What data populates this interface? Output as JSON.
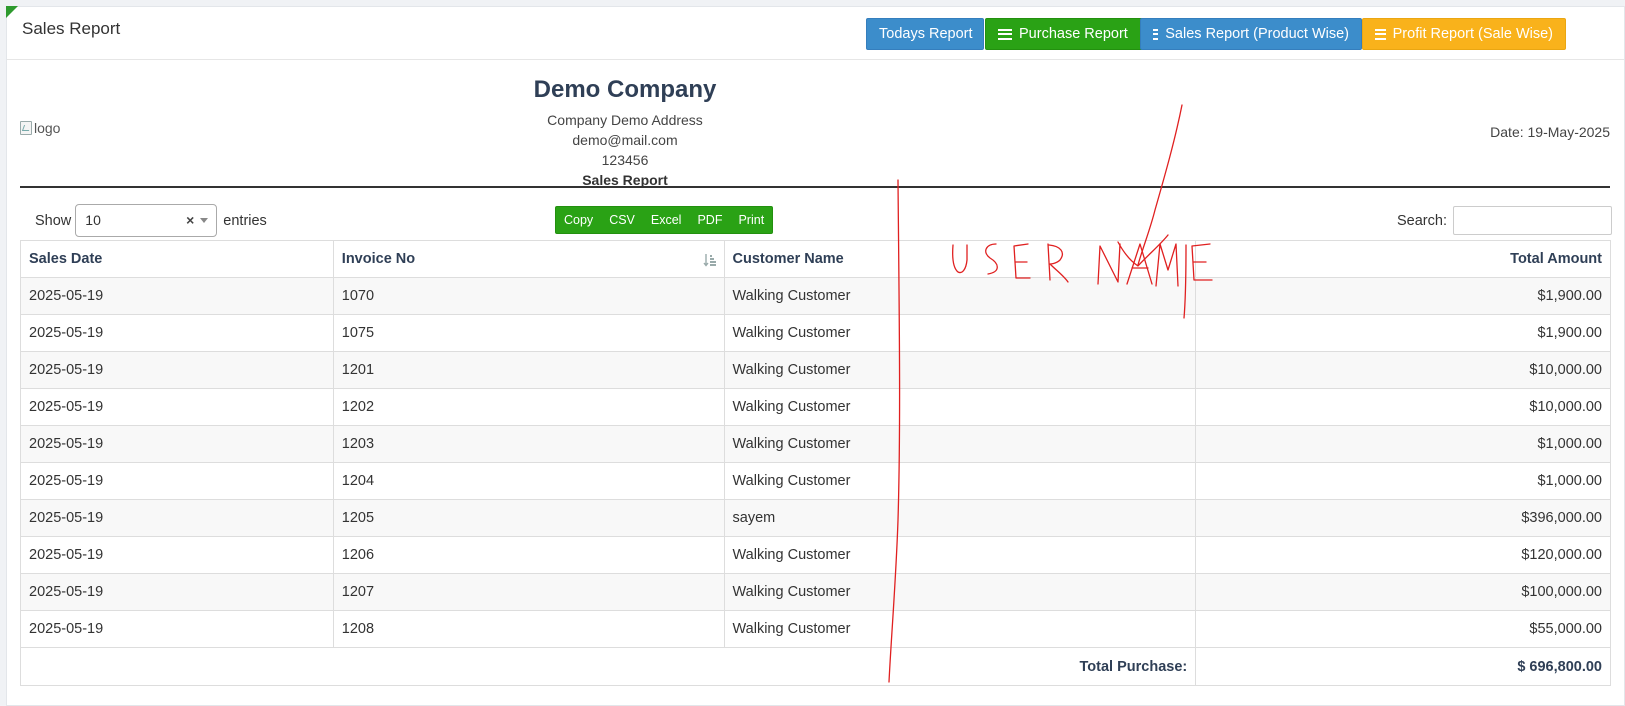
{
  "panel": {
    "title": "Sales Report"
  },
  "header_buttons": {
    "todays": "Todays Report",
    "purchase": "Purchase Report",
    "sales_product_wise": "Sales Report (Product Wise)",
    "profit_sale_wise": "Profit Report (Sale Wise)"
  },
  "logo": {
    "alt": "logo"
  },
  "company": {
    "name": "Demo Company",
    "address": "Company Demo Address",
    "email": "demo@mail.com",
    "phone": "123456",
    "report_title": "Sales Report"
  },
  "date_text": "Date: 19-May-2025",
  "length_menu": {
    "show": "Show",
    "value": "10",
    "entries": "entries"
  },
  "export_buttons": [
    "Copy",
    "CSV",
    "Excel",
    "PDF",
    "Print"
  ],
  "search": {
    "label": "Search:",
    "value": ""
  },
  "table": {
    "columns": [
      "Sales Date",
      "Invoice No",
      "Customer Name",
      "Total Amount"
    ],
    "rows": [
      [
        "2025-05-19",
        "1070",
        "Walking Customer",
        "$1,900.00"
      ],
      [
        "2025-05-19",
        "1075",
        "Walking Customer",
        "$1,900.00"
      ],
      [
        "2025-05-19",
        "1201",
        "Walking Customer",
        "$10,000.00"
      ],
      [
        "2025-05-19",
        "1202",
        "Walking Customer",
        "$10,000.00"
      ],
      [
        "2025-05-19",
        "1203",
        "Walking Customer",
        "$1,000.00"
      ],
      [
        "2025-05-19",
        "1204",
        "Walking Customer",
        "$1,000.00"
      ],
      [
        "2025-05-19",
        "1205",
        "sayem",
        "$396,000.00"
      ],
      [
        "2025-05-19",
        "1206",
        "Walking Customer",
        "$120,000.00"
      ],
      [
        "2025-05-19",
        "1207",
        "Walking Customer",
        "$100,000.00"
      ],
      [
        "2025-05-19",
        "1208",
        "Walking Customer",
        "$55,000.00"
      ]
    ],
    "total_label": "Total Purchase:",
    "total_value": "$ 696,800.00"
  },
  "annotation": {
    "text": "USER NAME",
    "color": "#e02020"
  },
  "colors": {
    "blue": "#3c8dcb",
    "green": "#2aa215",
    "orange": "#f9b21b"
  },
  "icons": {
    "header_button": "list-icon",
    "sort": "sort-icon"
  }
}
